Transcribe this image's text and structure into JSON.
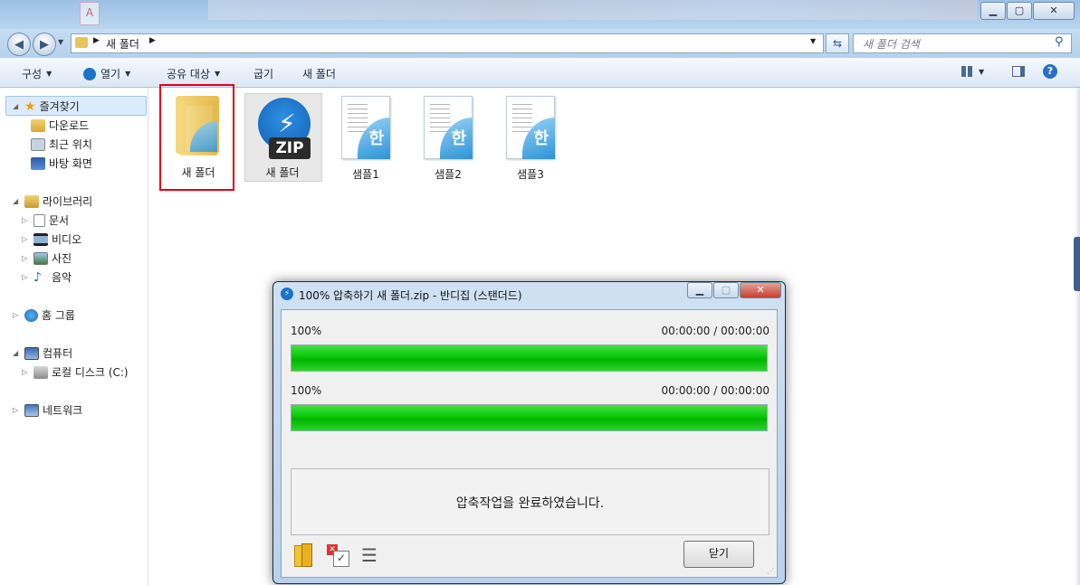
{
  "address": {
    "crumb": "새 폴더",
    "search_placeholder": "새 폴더 검색"
  },
  "toolbar": {
    "organize": "구성",
    "open": "열기",
    "share": "공유 대상",
    "burn": "굽기",
    "new_folder": "새 폴더"
  },
  "nav": {
    "favorites": "즐겨찾기",
    "downloads": "다운로드",
    "recent": "최근 위치",
    "desktop": "바탕 화면",
    "libraries": "라이브러리",
    "documents": "문서",
    "videos": "비디오",
    "pictures": "사진",
    "music": "음악",
    "homegroup": "홈 그룹",
    "computer": "컴퓨터",
    "local_disk": "로컬 디스크 (C:)",
    "network": "네트워크"
  },
  "files": [
    {
      "name": "새 폴더",
      "type": "folder"
    },
    {
      "name": "새 폴더",
      "type": "zip",
      "badge": "ZIP"
    },
    {
      "name": "샘플1",
      "type": "hwp",
      "glyph": "한"
    },
    {
      "name": "샘플2",
      "type": "hwp",
      "glyph": "한"
    },
    {
      "name": "샘플3",
      "type": "hwp",
      "glyph": "한"
    }
  ],
  "dialog": {
    "title": "100% 압축하기 새 폴더.zip - 반디집 (스탠더드)",
    "bar1": {
      "percent_label": "100%",
      "time": "00:00:00 / 00:00:00",
      "progress": 1.0
    },
    "bar2": {
      "percent_label": "100%",
      "time": "00:00:00 / 00:00:00",
      "progress": 1.0
    },
    "message": "압축작업을 완료하였습니다.",
    "close": "닫기"
  },
  "colors": {
    "progress_fill": "#00c800",
    "highlight": "#e0001b",
    "zip_blue": "#1a73c8"
  }
}
